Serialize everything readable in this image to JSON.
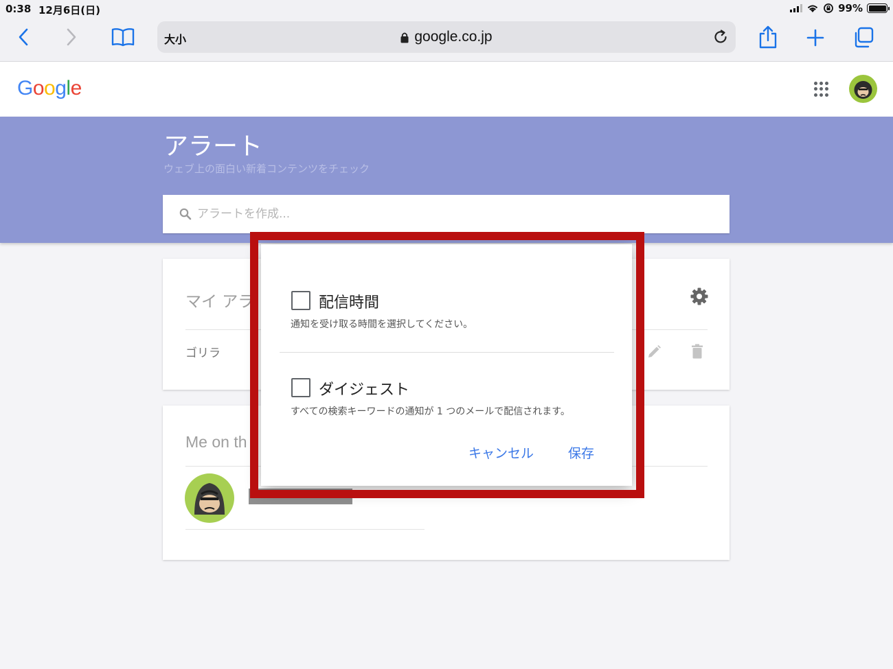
{
  "status_bar": {
    "time": "0:38",
    "date": "12月6日(日)",
    "battery": "99%"
  },
  "browser": {
    "text_size_label": "大小",
    "url": "google.co.jp"
  },
  "google": {
    "logo_letters": [
      {
        "char": "G",
        "color": "#4285F4"
      },
      {
        "char": "o",
        "color": "#EA4335"
      },
      {
        "char": "o",
        "color": "#FBBC05"
      },
      {
        "char": "g",
        "color": "#4285F4"
      },
      {
        "char": "l",
        "color": "#34A853"
      },
      {
        "char": "e",
        "color": "#EA4335"
      }
    ]
  },
  "banner": {
    "title": "アラート",
    "subtitle": "ウェブ上の面白い新着コンテンツをチェック",
    "search_placeholder": "アラートを作成..."
  },
  "my_alerts_card": {
    "title": "マイ アラ",
    "alert_name": "ゴリラ"
  },
  "me_card": {
    "title": "Me on th"
  },
  "dialog": {
    "option1": {
      "label": "配信時間",
      "description": "通知を受け取る時間を選択してください。"
    },
    "option2": {
      "label": "ダイジェスト",
      "description": "すべての検索キーワードの通知が 1 つのメールで配信されます。"
    },
    "cancel": "キャンセル",
    "save": "保存"
  },
  "colors": {
    "banner": "#8d97d3",
    "link_blue": "#3b78e7",
    "highlight_red": "#b90f0f",
    "ios_blue": "#1a73e8"
  }
}
